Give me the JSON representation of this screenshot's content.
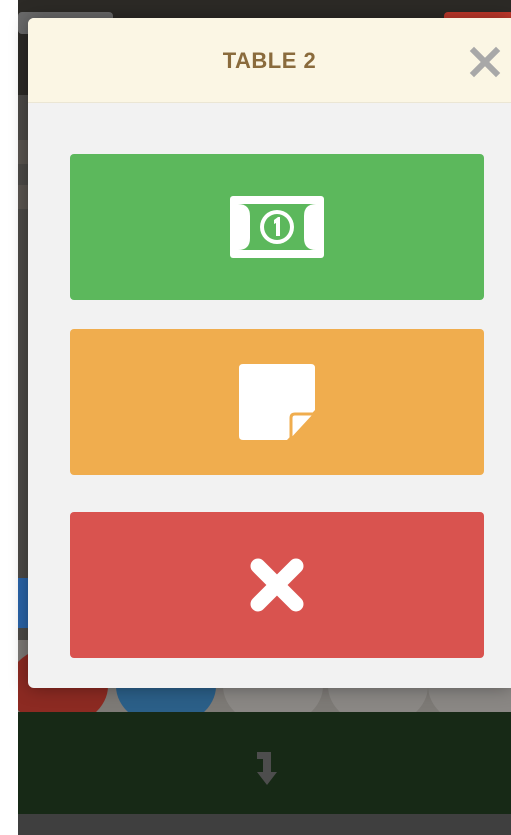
{
  "modal": {
    "title": "TABLE 2",
    "header_color": "#fbf6e4",
    "title_color": "#8a6b3c",
    "close_icon": "close-icon",
    "close_icon_color": "#a8a8a8"
  },
  "actions": [
    {
      "name": "pay-button",
      "icon": "money-bill-icon",
      "color": "#5cb85c"
    },
    {
      "name": "note-button",
      "icon": "sticky-note-icon",
      "color": "#f0ad4e"
    },
    {
      "name": "cancel-button",
      "icon": "close-icon",
      "color": "#d9534f"
    }
  ],
  "background": {
    "bottom_bar_icon": "turn-down-arrow-icon",
    "bottom_bar_color": "#172916"
  }
}
